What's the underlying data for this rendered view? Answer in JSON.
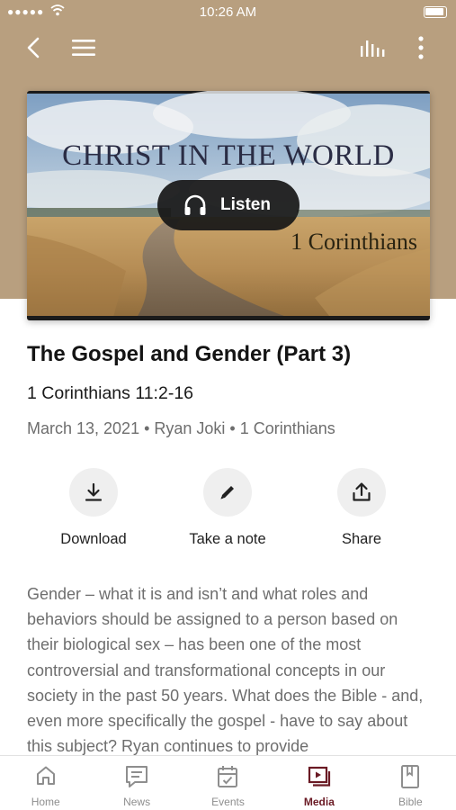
{
  "status_bar": {
    "time": "10:26 AM",
    "signal": "●●●●●"
  },
  "hero": {
    "title": "CHRIST IN THE WORLD",
    "subtitle": "1 Corinthians",
    "listen_label": "Listen"
  },
  "sermon": {
    "title": "The Gospel and Gender (Part 3)",
    "passage": "1 Corinthians 11:2-16",
    "meta": "March 13, 2021 • Ryan Joki • 1 Corinthians",
    "description": "Gender – what it is and isn’t and what roles and behaviors should be assigned to a person based on their biological sex – has been one of the most controversial and transformational concepts in our society in the past 50 years. What does the Bible - and, even more specifically the gospel - have to say about this subject? Ryan continues to provide"
  },
  "actions": [
    {
      "label": "Download",
      "icon": "download-icon"
    },
    {
      "label": "Take a note",
      "icon": "pencil-icon"
    },
    {
      "label": "Share",
      "icon": "share-icon"
    }
  ],
  "tabs": [
    {
      "label": "Home",
      "icon": "home-icon"
    },
    {
      "label": "News",
      "icon": "news-icon"
    },
    {
      "label": "Events",
      "icon": "calendar-icon"
    },
    {
      "label": "Media",
      "icon": "media-icon",
      "active": true
    },
    {
      "label": "Bible",
      "icon": "bible-icon"
    }
  ],
  "colors": {
    "header_bg": "#b89f7f",
    "accent": "#6a1a24",
    "tab_inactive": "#8e8e8e"
  }
}
